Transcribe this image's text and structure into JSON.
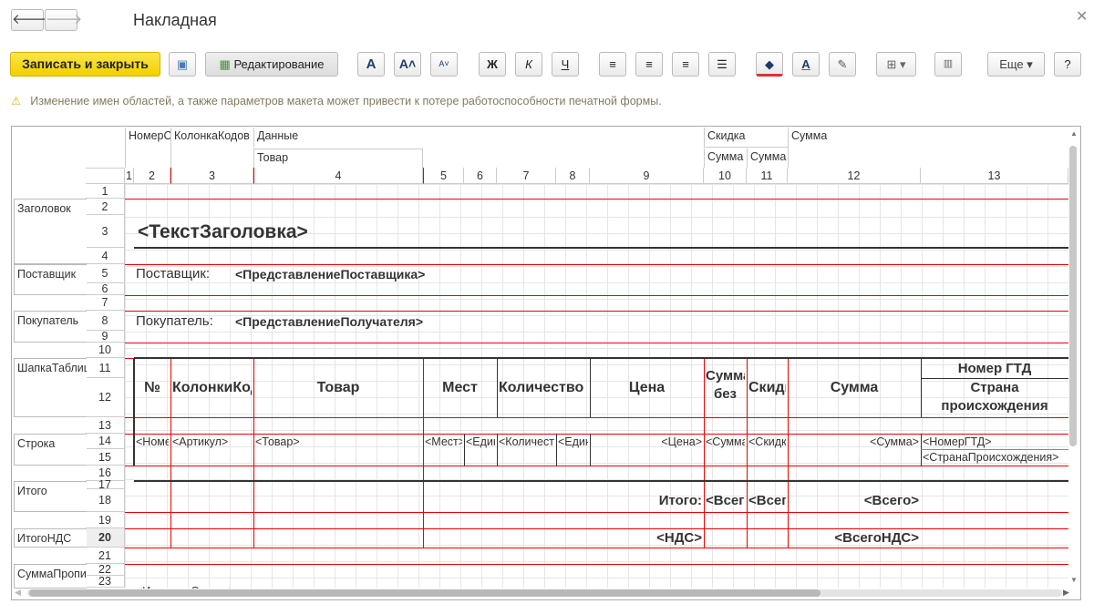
{
  "window": {
    "title": "Накладная",
    "back_icon": "arrow-left-icon",
    "forward_icon": "arrow-right-icon",
    "close_icon": "close-icon"
  },
  "toolbar": {
    "save_close": "Записать и закрыть",
    "edit_mode": "Редактирование",
    "bold": "Ж",
    "italic": "К",
    "underline": "Ч",
    "more": "Еще",
    "help": "?",
    "font_a": "A"
  },
  "warning": "Изменение имен областей, а также параметров макета может привести к потере работоспособности печатной формы.",
  "column_groups": {
    "nomer": "НомерС",
    "kolonka": "КолонкаКодов",
    "dannye": "Данные",
    "tovar": "Товар",
    "skidka": "Скидка",
    "skidka_summa": "Сумма",
    "skidka_summa2": "Сумма",
    "summa": "Сумма"
  },
  "columns": [
    "1",
    "2",
    "3",
    "4",
    "5",
    "6",
    "7",
    "8",
    "9",
    "10",
    "11",
    "12",
    "13"
  ],
  "rows": [
    "1",
    "2",
    "3",
    "4",
    "5",
    "6",
    "7",
    "8",
    "9",
    "10",
    "11",
    "12",
    "13",
    "14",
    "15",
    "16",
    "17",
    "18",
    "19",
    "20",
    "21",
    "22",
    "23"
  ],
  "regions": {
    "header": "Заголовок",
    "supplier": "Поставщик",
    "buyer": "Покупатель",
    "table_head": "ШапкаТаблицы",
    "row": "Строка",
    "total": "Итого",
    "total_vat": "ИтогоНДС",
    "sum_words": "СуммаПрописью"
  },
  "cells": {
    "title": "<ТекстЗаголовка>",
    "supplier_label": "Поставщик:",
    "supplier_value": "<ПредставлениеПоставщика>",
    "buyer_label": "Покупатель:",
    "buyer_value": "<ПредставлениеПолучателя>",
    "th_no": "№",
    "th_codes": "КолонкиКодов",
    "th_goods": "Товар",
    "th_places": "Мест",
    "th_qty": "Количество",
    "th_price": "Цена",
    "th_sum_disc": "Сумма без скидки",
    "th_disc": "Скидка",
    "th_sum": "Сумма",
    "th_gtd": "Номер ГТД",
    "th_country": "Страна происхождения",
    "r_no": "<НомерСтроки>",
    "r_art": "<Артикул>",
    "r_goods": "<Товар>",
    "r_places": "<Мест>",
    "r_unit": "<Единица>",
    "r_qty": "<Количество>",
    "r_unit2": "<Единица>",
    "r_price": "<Цена>",
    "r_sumdisc": "<СуммаБезСкидки>",
    "r_disc": "<Скидка>",
    "r_sum": "<Сумма>",
    "r_gtd": "<НомерГТД>",
    "r_country": "<СтранаПроисхождения>",
    "t_label": "Итого:",
    "t_sumdisc": "<ВсегоБезСкидок>",
    "t_disc": "<ВсегоСкидок>",
    "t_total": "<Всего>",
    "v_vat": "<НДС>",
    "v_total": "<ВсегоНДС>",
    "final": "<ИтоговаяСтрока>"
  }
}
